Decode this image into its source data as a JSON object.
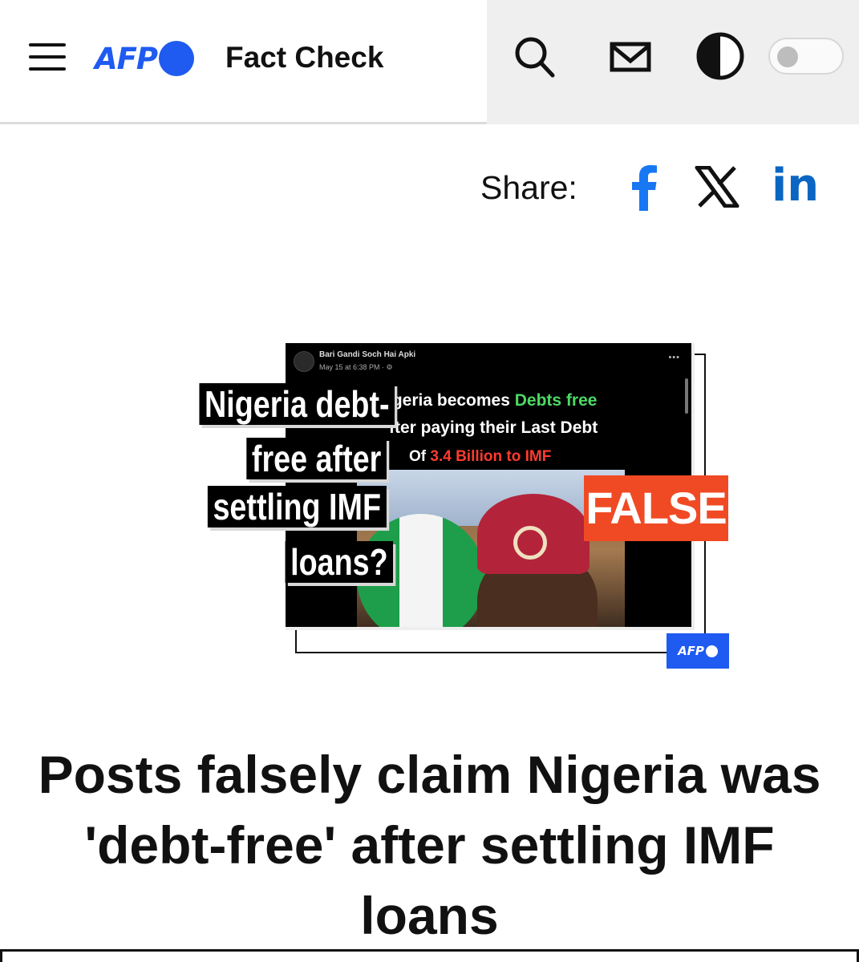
{
  "header": {
    "logo_text": "AFP",
    "brand_title": "Fact Check",
    "accent_color": "#1f5bf0",
    "icons": [
      "menu-icon",
      "search-icon",
      "mail-icon",
      "contrast-icon",
      "theme-toggle"
    ]
  },
  "share": {
    "label": "Share:",
    "linkedin_label": "in",
    "networks": [
      "facebook-icon",
      "x-icon",
      "linkedin-icon"
    ]
  },
  "hero": {
    "post_author": "Bari Gandi Soch Hai Apki",
    "post_date": "May 15 at 6:38 PM · ⚙",
    "post_more": "•••",
    "post_line1_a": "igeria becomes",
    "post_line1_b": "Debts free",
    "post_line2": "fter paying their Last Debt",
    "post_line3_a": "Of",
    "post_line3_b": "3.4 Billion to IMF",
    "claim_lines": [
      "Nigeria debt-",
      "free after",
      "settling IMF",
      "loans?"
    ],
    "verdict": "FALSE",
    "verdict_color": "#f04a24",
    "watermark": "AFP"
  },
  "article": {
    "headline": "Posts falsely claim Nigeria was 'debt-free' after settling IMF loans"
  }
}
